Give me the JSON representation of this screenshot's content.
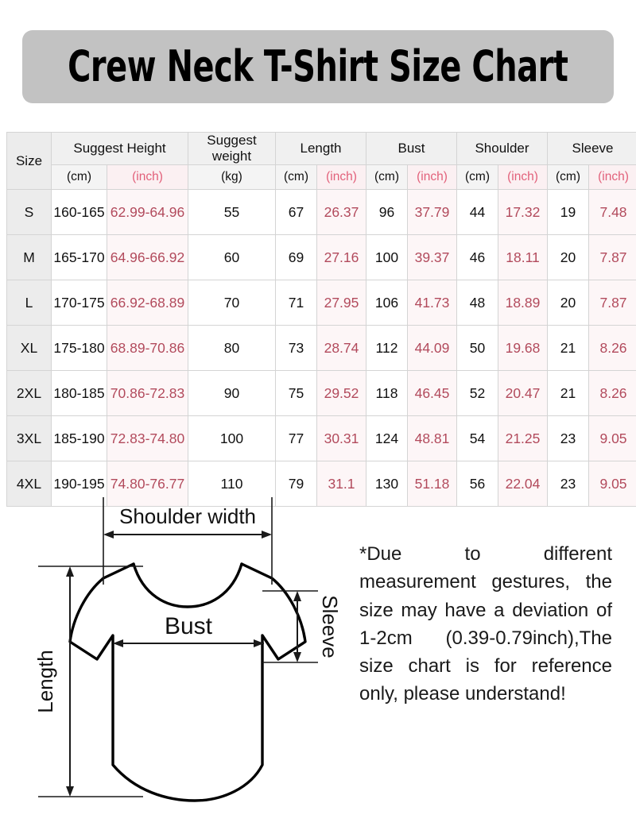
{
  "title": "Crew Neck T-Shirt Size Chart",
  "accent_colors": {
    "banner_gray": "#c2c2c2",
    "inch_text": "#b24a5c",
    "inch_header_text": "#e2607a",
    "inch_cell_bg": "#fdf6f7",
    "size_col_bg": "#ececec",
    "header_bg": "#f0f0f0"
  },
  "table": {
    "group_headers": [
      {
        "label": "Size",
        "span": 1,
        "rows": 2
      },
      {
        "label": "Suggest Height",
        "span": 2
      },
      {
        "label": "Suggest weight",
        "span": 1
      },
      {
        "label": "Length",
        "span": 2
      },
      {
        "label": "Bust",
        "span": 2
      },
      {
        "label": "Shoulder",
        "span": 2
      },
      {
        "label": "Sleeve",
        "span": 2
      }
    ],
    "unit_headers": [
      "(cm)",
      "(inch)",
      "(kg)",
      "(cm)",
      "(inch)",
      "(cm)",
      "(inch)",
      "(cm)",
      "(inch)",
      "(cm)",
      "(inch)"
    ],
    "rows": [
      {
        "size": "S",
        "height_cm": "160-165",
        "height_inch": "62.99-64.96",
        "weight_kg": "55",
        "length_cm": "67",
        "length_inch": "26.37",
        "bust_cm": "96",
        "bust_inch": "37.79",
        "shoulder_cm": "44",
        "shoulder_inch": "17.32",
        "sleeve_cm": "19",
        "sleeve_inch": "7.48"
      },
      {
        "size": "M",
        "height_cm": "165-170",
        "height_inch": "64.96-66.92",
        "weight_kg": "60",
        "length_cm": "69",
        "length_inch": "27.16",
        "bust_cm": "100",
        "bust_inch": "39.37",
        "shoulder_cm": "46",
        "shoulder_inch": "18.11",
        "sleeve_cm": "20",
        "sleeve_inch": "7.87"
      },
      {
        "size": "L",
        "height_cm": "170-175",
        "height_inch": "66.92-68.89",
        "weight_kg": "70",
        "length_cm": "71",
        "length_inch": "27.95",
        "bust_cm": "106",
        "bust_inch": "41.73",
        "shoulder_cm": "48",
        "shoulder_inch": "18.89",
        "sleeve_cm": "20",
        "sleeve_inch": "7.87"
      },
      {
        "size": "XL",
        "height_cm": "175-180",
        "height_inch": "68.89-70.86",
        "weight_kg": "80",
        "length_cm": "73",
        "length_inch": "28.74",
        "bust_cm": "112",
        "bust_inch": "44.09",
        "shoulder_cm": "50",
        "shoulder_inch": "19.68",
        "sleeve_cm": "21",
        "sleeve_inch": "8.26"
      },
      {
        "size": "2XL",
        "height_cm": "180-185",
        "height_inch": "70.86-72.83",
        "weight_kg": "90",
        "length_cm": "75",
        "length_inch": "29.52",
        "bust_cm": "118",
        "bust_inch": "46.45",
        "shoulder_cm": "52",
        "shoulder_inch": "20.47",
        "sleeve_cm": "21",
        "sleeve_inch": "8.26"
      },
      {
        "size": "3XL",
        "height_cm": "185-190",
        "height_inch": "72.83-74.80",
        "weight_kg": "100",
        "length_cm": "77",
        "length_inch": "30.31",
        "bust_cm": "124",
        "bust_inch": "48.81",
        "shoulder_cm": "54",
        "shoulder_inch": "21.25",
        "sleeve_cm": "23",
        "sleeve_inch": "9.05"
      },
      {
        "size": "4XL",
        "height_cm": "190-195",
        "height_inch": "74.80-76.77",
        "weight_kg": "110",
        "length_cm": "79",
        "length_inch": "31.1",
        "bust_cm": "130",
        "bust_inch": "51.18",
        "shoulder_cm": "56",
        "shoulder_inch": "22.04",
        "sleeve_cm": "23",
        "sleeve_inch": "9.05"
      }
    ]
  },
  "diagram": {
    "shoulder_label": "Shoulder width",
    "bust_label": "Bust",
    "length_label": "Length",
    "sleeve_label": "Sleeve"
  },
  "note": "*Due to different measurement gestures, the size may have a deviation of 1-2cm (0.39-0.79inch),The size chart is for reference only, please understand!"
}
